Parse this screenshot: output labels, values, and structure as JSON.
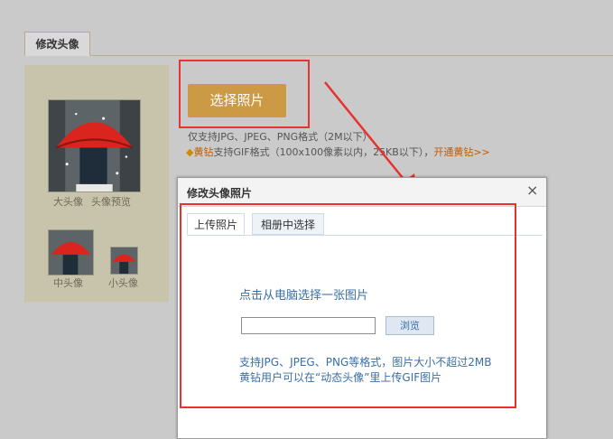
{
  "page": {
    "tab_title": "修改头像",
    "choose_photo_button": "选择照片",
    "support_note": "仅支持JPG、JPEG、PNG格式（2M以下）",
    "diamond_link": "黄钻",
    "diamond_note": "支持GIF格式（100x100像素以内，25KB以下），",
    "open_diamond": "开通黄钻>>"
  },
  "preview": {
    "large_caption": "大头像",
    "preview_caption": "头像预览",
    "medium_caption": "中头像",
    "small_caption": "小头像"
  },
  "dialog": {
    "title": "修改头像照片",
    "close": "×",
    "tabs": [
      {
        "label": "上传照片",
        "active": true
      },
      {
        "label": "相册中选择",
        "active": false
      }
    ],
    "upload_prompt": "点击从电脑选择一张图片",
    "file_value": "",
    "browse_label": "浏览",
    "format_note": "支持JPG、JPEG、PNG等格式，图片大小不超过2MB",
    "gif_note": "黄钻用户可以在“动态头像”里上传GIF图片"
  },
  "colors": {
    "accent_button": "#cc9944",
    "highlight_red": "#e8322f",
    "link_blue": "#3a6ea5",
    "diamond_orange": "#c25a00"
  },
  "icons": [
    "diamond-icon",
    "close-icon",
    "red-arrow-annotation"
  ]
}
